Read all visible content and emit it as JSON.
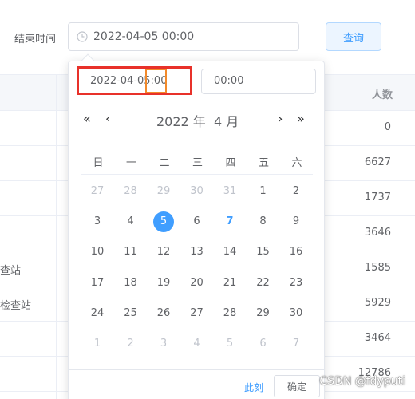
{
  "filter": {
    "label": "结束时间",
    "end_value": "2022-04-05 00:00",
    "query_label": "查询"
  },
  "table": {
    "people_header": "人数",
    "rows": [
      {
        "name": "",
        "count": "0"
      },
      {
        "name": "",
        "count": "6627"
      },
      {
        "name": "",
        "count": "1737"
      },
      {
        "name": "",
        "count": "3646"
      },
      {
        "name": "查站",
        "count": "1585"
      },
      {
        "name": "检查站",
        "count": "5929"
      },
      {
        "name": "",
        "count": "3464"
      },
      {
        "name": "",
        "count": "12786"
      }
    ]
  },
  "picker": {
    "date_value": "2022-04-05:00",
    "time_value": "00:00",
    "nav": {
      "prev_year": "«",
      "prev_month": "‹",
      "next_month": "›",
      "next_year": "»"
    },
    "title": "2022 年  4 月",
    "weekdays": [
      "日",
      "一",
      "二",
      "三",
      "四",
      "五",
      "六"
    ],
    "weeks": [
      [
        "27",
        "28",
        "29",
        "30",
        "31",
        "1",
        "2"
      ],
      [
        "3",
        "4",
        "5",
        "6",
        "7",
        "8",
        "9"
      ],
      [
        "10",
        "11",
        "12",
        "13",
        "14",
        "15",
        "16"
      ],
      [
        "17",
        "18",
        "19",
        "20",
        "21",
        "22",
        "23"
      ],
      [
        "24",
        "25",
        "26",
        "27",
        "28",
        "29",
        "30"
      ],
      [
        "1",
        "2",
        "3",
        "4",
        "5",
        "6",
        "7"
      ]
    ],
    "muted_first_week_count": 5,
    "selected_day": "5",
    "today_day": "7",
    "now_label": "此刻",
    "confirm_label": "确定"
  },
  "watermark": "CSDN @fdyputi",
  "colors": {
    "accent": "#409eff",
    "highlight_red": "#e8312a",
    "highlight_orange": "#f28a2b"
  }
}
